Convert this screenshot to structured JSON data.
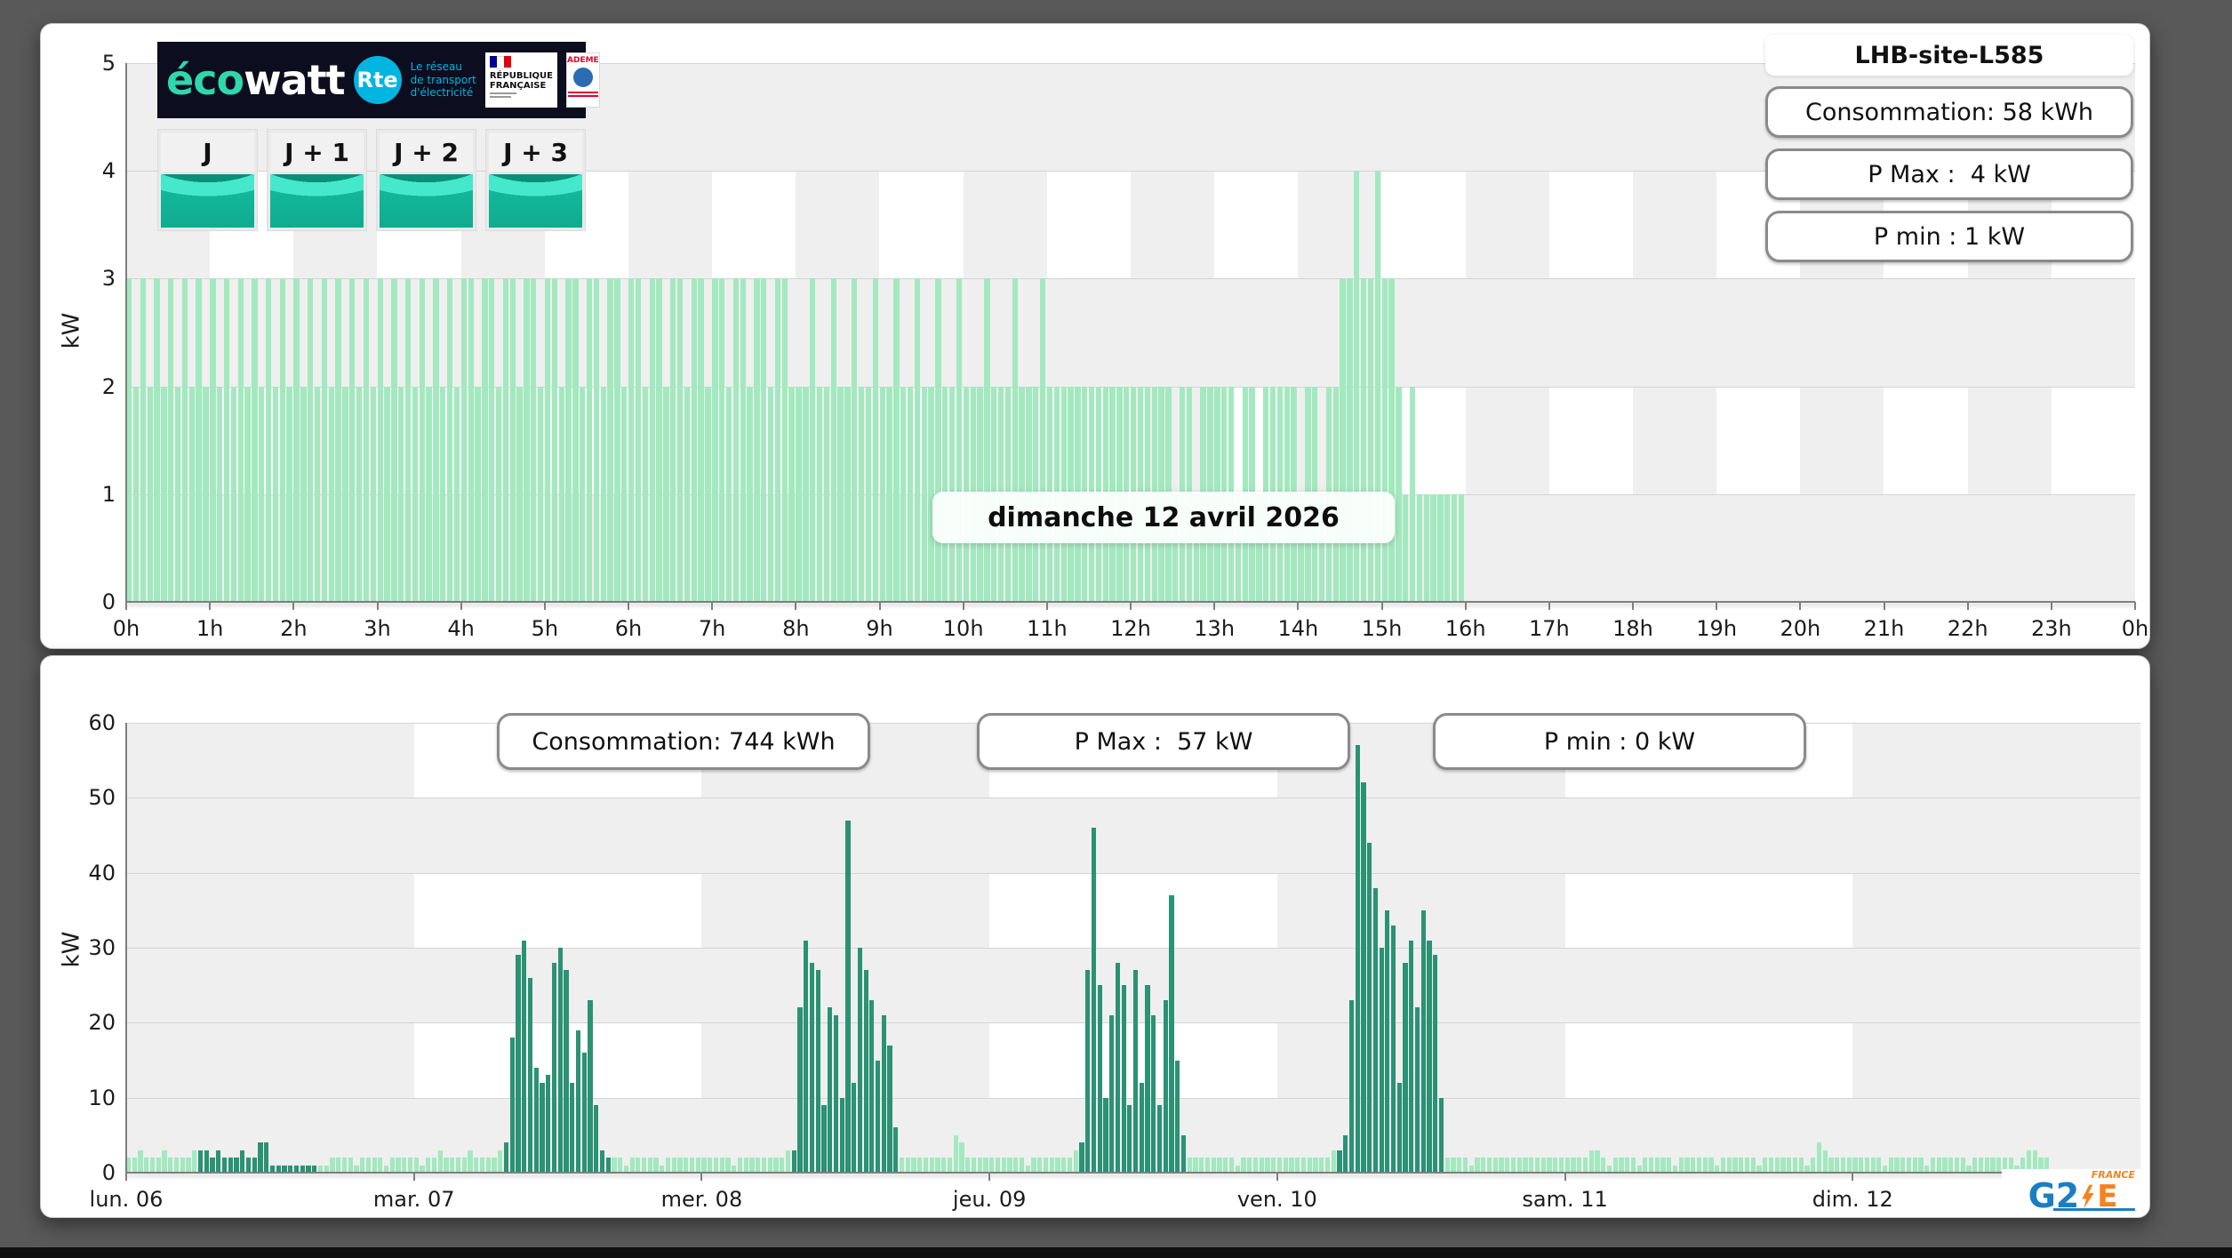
{
  "page": {
    "background": "#595959"
  },
  "daily": {
    "site_title": "LHB-site-L585",
    "stats": [
      "Consommation: 58 kWh",
      "P Max :  4 kW",
      "P min : 1 kW"
    ],
    "tabs": [
      "J",
      "J + 1",
      "J + 2",
      "J + 3"
    ],
    "logo": {
      "brand_eco": "éco",
      "brand_watt": "watt",
      "rte_abbr": "Rte",
      "rte_lines": [
        "Le réseau",
        "de transport",
        "d'électricité"
      ],
      "republique_lines": [
        "RÉPUBLIQUE",
        "FRANÇAISE"
      ],
      "ademe": "ADEME"
    }
  },
  "weekly": {
    "stats": [
      "Consommation: 744 kWh",
      "P Max :  57 kW",
      "P min : 0 kW"
    ],
    "g2e": {
      "g2": "G2",
      "e": "E",
      "france": "FRANCE"
    }
  },
  "chart_data": [
    {
      "type": "bar",
      "title": "dimanche 12 avril 2026",
      "ylabel": "kW",
      "ylim": [
        0,
        5
      ],
      "yticks": [
        0,
        1,
        2,
        3,
        4,
        5
      ],
      "x_divisions": 24,
      "x_tick_labels": [
        "0h",
        "1h",
        "2h",
        "3h",
        "4h",
        "5h",
        "6h",
        "7h",
        "8h",
        "9h",
        "10h",
        "11h",
        "12h",
        "13h",
        "14h",
        "15h",
        "16h",
        "17h",
        "18h",
        "19h",
        "20h",
        "21h",
        "22h",
        "23h",
        "0h"
      ],
      "slot_minutes": 5,
      "bar_color": "#a3e9bf",
      "row_band_unit": 1,
      "checker_cells": 24,
      "grid": true,
      "legend": "none",
      "values": [
        3,
        2,
        3,
        2,
        3,
        2,
        3,
        2,
        3,
        2,
        3,
        2,
        3,
        2,
        3,
        2,
        3,
        2,
        3,
        2,
        3,
        2,
        3,
        2,
        3,
        2,
        3,
        2,
        3,
        2,
        3,
        2,
        3,
        2,
        3,
        2,
        3,
        2,
        3,
        2,
        3,
        2,
        3,
        2,
        3,
        2,
        3,
        2,
        3,
        3,
        2,
        3,
        3,
        2,
        3,
        3,
        2,
        3,
        3,
        2,
        3,
        3,
        2,
        3,
        3,
        2,
        3,
        3,
        2,
        3,
        3,
        2,
        3,
        3,
        2,
        3,
        3,
        2,
        3,
        3,
        2,
        3,
        3,
        2,
        3,
        3,
        2,
        3,
        3,
        2,
        3,
        3,
        2,
        3,
        3,
        2,
        2,
        2,
        3,
        2,
        2,
        3,
        2,
        2,
        3,
        2,
        2,
        3,
        2,
        2,
        3,
        2,
        2,
        3,
        2,
        2,
        3,
        2,
        2,
        3,
        2,
        2,
        2,
        3,
        2,
        2,
        2,
        3,
        2,
        2,
        2,
        3,
        2,
        2,
        2,
        2,
        2,
        2,
        2,
        2,
        2,
        2,
        2,
        2,
        2,
        2,
        2,
        2,
        2,
        2,
        1,
        2,
        2,
        1,
        2,
        2,
        2,
        2,
        2,
        1,
        2,
        2,
        1,
        2,
        2,
        2,
        2,
        2,
        1,
        2,
        2,
        1,
        2,
        2,
        3,
        3,
        4,
        3,
        3,
        4,
        3,
        3,
        2,
        1,
        2,
        1,
        1,
        1,
        1,
        1,
        1,
        1,
        0,
        0,
        0,
        0,
        0,
        0,
        0,
        0,
        0,
        0,
        0,
        0,
        0,
        0,
        0,
        0,
        0,
        0,
        0,
        0,
        0,
        0,
        0,
        0,
        0,
        0,
        0,
        0,
        0,
        0,
        0,
        0,
        0,
        0,
        0,
        0,
        0,
        0,
        0,
        0,
        0,
        0,
        0,
        0,
        0,
        0,
        0,
        0,
        0,
        0,
        0,
        0,
        0,
        0,
        0,
        0,
        0,
        0,
        0,
        0,
        0,
        0,
        0,
        0,
        0,
        0,
        0,
        0,
        0,
        0,
        0,
        0,
        0,
        0,
        0,
        0,
        0,
        0,
        0,
        0,
        0,
        0,
        0,
        0,
        0,
        0,
        0,
        0,
        0,
        0,
        0,
        0,
        0,
        0,
        0,
        0
      ]
    },
    {
      "type": "bar",
      "title": "",
      "ylabel": "kW",
      "ylim": [
        0,
        60
      ],
      "yticks": [
        0,
        10,
        20,
        30,
        40,
        50,
        60
      ],
      "x_divisions": 7,
      "x_tick_labels": [
        "lun. 06",
        "mar. 07",
        "mer. 08",
        "jeu. 09",
        "ven. 10",
        "sam. 11",
        "dim. 12"
      ],
      "slot_minutes": 30,
      "bar_color": "#a3e9bf",
      "bar_color_dark": "#2b9273",
      "dark_ranges": [
        [
          12,
          31
        ],
        [
          63,
          80
        ],
        [
          111,
          128
        ],
        [
          159,
          176
        ],
        [
          202,
          219
        ]
      ],
      "row_band_unit": 10,
      "checker_cells": 7,
      "grid": true,
      "legend": "none",
      "values": [
        2,
        2,
        3,
        2,
        2,
        2,
        3,
        2,
        2,
        2,
        2,
        3,
        3,
        3,
        2,
        3,
        2,
        2,
        2,
        3,
        2,
        2,
        4,
        4,
        1,
        1,
        1,
        1,
        1,
        1,
        1,
        1,
        1,
        1,
        2,
        2,
        2,
        2,
        1,
        2,
        2,
        2,
        2,
        1,
        2,
        2,
        2,
        2,
        2,
        1,
        2,
        2,
        3,
        2,
        2,
        2,
        2,
        3,
        2,
        2,
        2,
        2,
        3,
        4,
        18,
        29,
        31,
        26,
        14,
        12,
        13,
        28,
        30,
        27,
        12,
        19,
        16,
        23,
        9,
        3,
        2,
        2,
        2,
        1,
        2,
        2,
        2,
        2,
        2,
        1,
        2,
        2,
        2,
        2,
        2,
        2,
        2,
        2,
        2,
        2,
        2,
        1,
        2,
        2,
        2,
        2,
        2,
        2,
        2,
        2,
        3,
        3,
        22,
        31,
        28,
        27,
        9,
        22,
        21,
        10,
        47,
        12,
        30,
        27,
        23,
        15,
        21,
        17,
        6,
        2,
        2,
        2,
        2,
        2,
        2,
        2,
        2,
        2,
        5,
        4,
        2,
        2,
        2,
        2,
        2,
        2,
        2,
        2,
        2,
        2,
        1,
        2,
        2,
        2,
        2,
        2,
        2,
        2,
        3,
        4,
        27,
        46,
        25,
        10,
        21,
        28,
        25,
        9,
        27,
        12,
        25,
        21,
        9,
        23,
        37,
        15,
        5,
        2,
        2,
        2,
        2,
        2,
        2,
        2,
        2,
        1,
        2,
        2,
        2,
        2,
        2,
        2,
        2,
        2,
        2,
        2,
        2,
        2,
        2,
        2,
        2,
        3,
        3,
        5,
        23,
        57,
        52,
        44,
        38,
        30,
        35,
        33,
        12,
        28,
        31,
        22,
        35,
        31,
        29,
        10,
        2,
        2,
        2,
        2,
        1,
        2,
        2,
        2,
        2,
        2,
        2,
        2,
        2,
        2,
        2,
        2,
        2,
        2,
        2,
        2,
        2,
        2,
        2,
        2,
        3,
        3,
        2,
        1,
        2,
        2,
        2,
        2,
        1,
        2,
        2,
        2,
        2,
        2,
        1,
        2,
        2,
        2,
        2,
        2,
        2,
        1,
        2,
        2,
        2,
        2,
        2,
        2,
        1,
        2,
        2,
        2,
        2,
        2,
        2,
        2,
        1,
        2,
        4,
        3,
        2,
        2,
        2,
        2,
        2,
        2,
        2,
        2,
        2,
        1,
        2,
        2,
        2,
        2,
        2,
        2,
        1,
        2,
        2,
        2,
        2,
        2,
        2,
        1,
        2,
        2,
        2,
        2,
        2,
        2,
        2,
        1,
        2,
        3,
        3,
        2,
        2,
        0,
        0,
        0,
        0,
        0,
        0,
        0,
        0,
        0,
        0,
        0,
        0,
        0,
        0,
        0
      ]
    }
  ]
}
